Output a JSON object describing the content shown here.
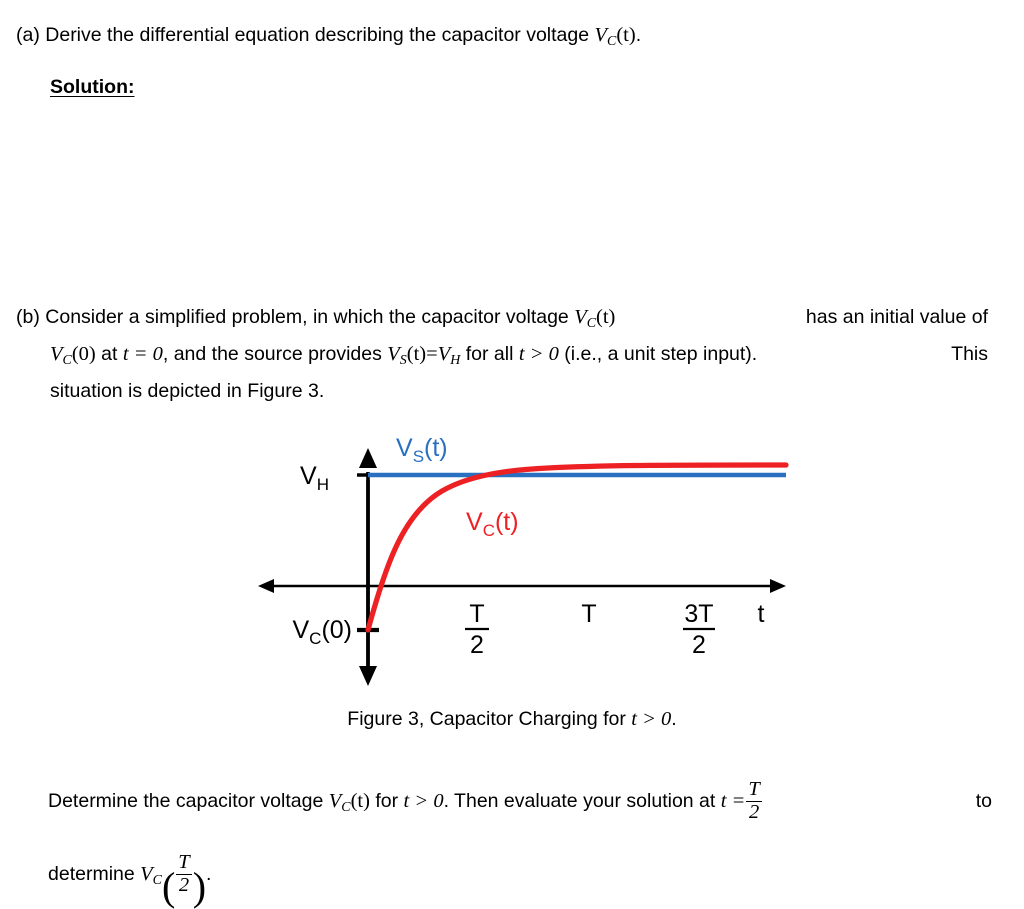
{
  "part_a": {
    "marker": "(a)",
    "text_before": "Derive the differential equation describing the capacitor voltage",
    "math_vc": "V",
    "math_vc_sub": "C",
    "math_vc_arg": "(t)",
    "trailing": "."
  },
  "solution": {
    "label": "Solution:"
  },
  "part_b": {
    "marker": "(b)",
    "line1_a": "Consider  a  simplified  problem,  in  which  the  capacitor  voltage",
    "line1_math": "V",
    "line1_math_sub": "C",
    "line1_math_arg": "(t)",
    "line1_b": "has  an  initial  value  of",
    "line2_math1": "V",
    "line2_math1_sub": "C",
    "line2_math1_arg": "(0)",
    "line2_a": "at",
    "line2_math2": "t = 0",
    "line2_b": ", and the source provides",
    "line2_math3": "V",
    "line2_math3_sub": "S",
    "line2_math3_arg": "(t)",
    "line2_math3_eq": "=",
    "line2_math4": "V",
    "line2_math4_sub": "H",
    "line2_c": "for all",
    "line2_math5": "t > 0",
    "line2_d": "(i.e., a unit step input).",
    "line2_e": "This",
    "line3": "situation is depicted in Figure 3."
  },
  "figure": {
    "caption_prefix": "Figure 3, Capacitor Charging for",
    "caption_math": "t > 0",
    "caption_suffix": ".",
    "y_label_top": "V",
    "y_label_top_sub": "H",
    "y_label_bottom": "V",
    "y_label_bottom_sub": "C",
    "y_label_bottom_arg": "(0)",
    "series_blue_label": "V",
    "series_blue_label_sub": "S",
    "series_blue_label_arg": "(t)",
    "series_red_label": "V",
    "series_red_label_sub": "C",
    "series_red_label_arg": "(t)",
    "x_axis_label": "t",
    "tick_1_num": "T",
    "tick_1_den": "2",
    "tick_2": "T",
    "tick_3_num": "3T",
    "tick_3_den": "2",
    "color_blue": "#2a70c0",
    "color_red": "#ed2024",
    "color_axis": "#000000"
  },
  "closing": {
    "line1_a": "Determine  the  capacitor  voltage",
    "line1_math1": "V",
    "line1_math1_sub": "C",
    "line1_math1_arg": "(t)",
    "line1_b": "for",
    "line1_math2": "t > 0",
    "line1_c": ".  Then  evaluate  your  solution  at",
    "line1_math3_lhs": "t =",
    "line1_frac_num": "T",
    "line1_frac_den": "2",
    "line1_d": "to",
    "line2_a": "determine",
    "line2_math": "V",
    "line2_math_sub": "C",
    "line2_frac_num": "T",
    "line2_frac_den": "2",
    "line2_b": "."
  },
  "chart_data": {
    "type": "line",
    "title": "Figure 3, Capacitor Charging for t > 0",
    "xlabel": "t",
    "ylabel": "",
    "xticks": [
      "T/2",
      "T",
      "3T/2"
    ],
    "xtick_values": [
      0.5,
      1.0,
      1.5
    ],
    "yticks": [
      "V_H",
      "V_C(0)"
    ],
    "ytick_values": [
      1.0,
      -0.62
    ],
    "xlim": [
      -0.22,
      1.95
    ],
    "ylim": [
      -1.05,
      1.35
    ],
    "grid": false,
    "legend": "inline-annotations",
    "series": [
      {
        "name": "V_S(t)",
        "color": "#2a70c0",
        "type": "step",
        "description": "constant at V_H for all t > 0",
        "x": [
          0,
          2.0
        ],
        "values": [
          1.0,
          1.0
        ]
      },
      {
        "name": "V_C(t)",
        "color": "#ed2024",
        "type": "exponential-charge",
        "description": "V_C(t) = V_H + (V_C(0) - V_H) * exp(-t/tau), starts at V_C(0) below zero and asymptotes to V_H",
        "x": [
          0.0,
          0.1,
          0.2,
          0.3,
          0.4,
          0.5,
          0.6,
          0.7,
          0.8,
          0.9,
          1.0,
          1.25,
          1.5,
          1.75,
          2.0
        ],
        "values": [
          -0.62,
          -0.17,
          0.15,
          0.39,
          0.55,
          0.67,
          0.76,
          0.82,
          0.87,
          0.9,
          0.93,
          0.97,
          0.99,
          1.0,
          1.0
        ]
      }
    ]
  }
}
